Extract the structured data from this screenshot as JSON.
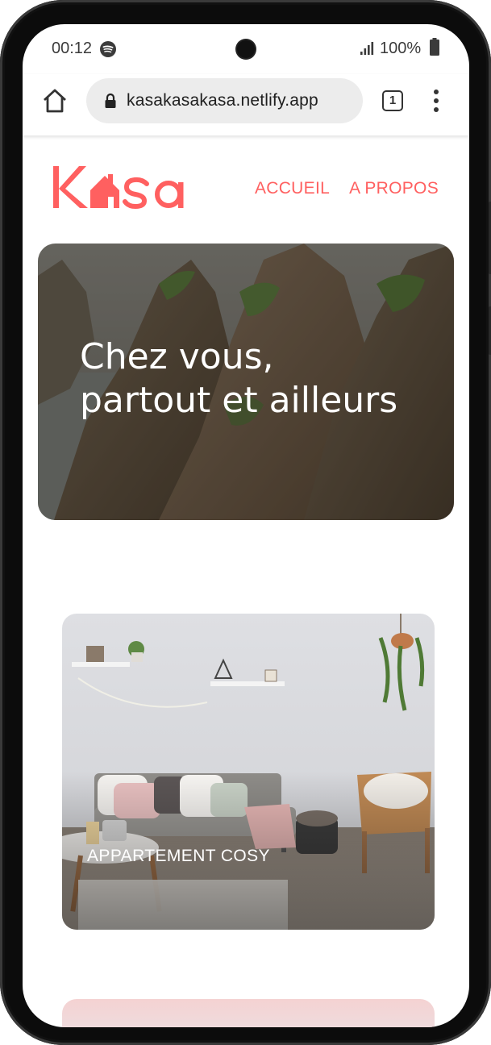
{
  "status_bar": {
    "time": "00:12",
    "battery": "100%",
    "icons": [
      "spotify-icon",
      "camera",
      "signal-icon",
      "battery-icon"
    ]
  },
  "browser": {
    "url": "kasakasakasa.netlify.app",
    "tab_count": "1",
    "icons": [
      "home-icon",
      "lock-icon",
      "tabs-icon",
      "menu-icon"
    ]
  },
  "site": {
    "brand_color": "#ff6060",
    "logo_text": "Kasa",
    "nav": [
      "ACCUEIL",
      "A PROPOS"
    ],
    "hero": {
      "line1": "Chez vous,",
      "line2": "partout et ailleurs"
    },
    "cards": [
      {
        "title": "APPARTEMENT COSY"
      }
    ]
  }
}
